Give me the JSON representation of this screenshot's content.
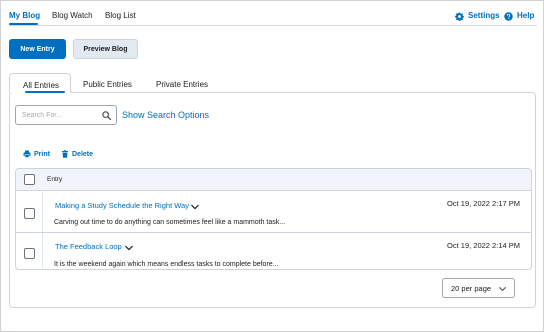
{
  "nav": {
    "tabs": [
      {
        "label": "My Blog"
      },
      {
        "label": "Blog Watch"
      },
      {
        "label": "Blog List"
      }
    ],
    "settings_label": "Settings",
    "help_label": "Help"
  },
  "toolbar": {
    "new_entry_label": "New Entry",
    "preview_blog_label": "Preview Blog"
  },
  "subtabs": [
    {
      "label": "All Entries"
    },
    {
      "label": "Public Entries"
    },
    {
      "label": "Private Entries"
    }
  ],
  "search": {
    "placeholder": "Search For...",
    "value": "",
    "show_options_label": "Show Search Options"
  },
  "actions": {
    "print_label": "Print",
    "delete_label": "Delete"
  },
  "table": {
    "header": "Entry",
    "rows": [
      {
        "title": "Making a Study Schedule the Right Way",
        "excerpt": "Carving out time to do anything can sometimes feel like a mammoth task...",
        "date": "Oct 19, 2022 2:17 PM"
      },
      {
        "title": "The Feedback Loop",
        "excerpt": "It is the weekend again which means endless tasks to complete before...",
        "date": "Oct 19, 2022 2:14 PM"
      }
    ]
  },
  "pagination": {
    "per_page": "20 per page"
  },
  "colors": {
    "accent": "#006fbf",
    "border": "#cdd5dc",
    "header_bg": "#f1f5fb"
  }
}
